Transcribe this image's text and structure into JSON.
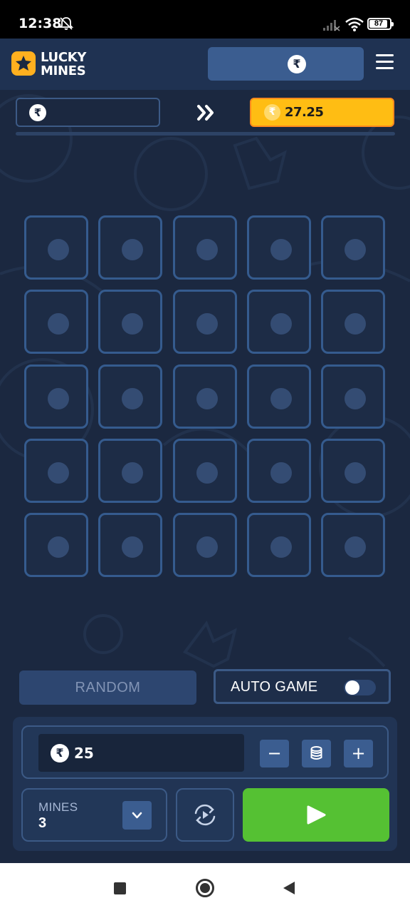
{
  "status_bar": {
    "time": "12:38",
    "battery": "87"
  },
  "header": {
    "logo_line1": "LUCKY",
    "logo_line2": "MINES",
    "currency_symbol": "₹"
  },
  "win_bar": {
    "current_symbol": "₹",
    "next_symbol": "₹",
    "next_value": "27.25"
  },
  "grid": {
    "rows": 5,
    "cols": 5
  },
  "controls": {
    "random_label": "RANDOM",
    "auto_game_label": "AUTO GAME",
    "auto_game_on": false
  },
  "bet": {
    "currency_symbol": "₹",
    "amount": "25",
    "minus_label": "−",
    "plus_label": "+"
  },
  "mines": {
    "label": "MINES",
    "value": "3"
  },
  "colors": {
    "background": "#1b2840",
    "accent_yellow": "#ffbd13",
    "play_green": "#55c133",
    "tile_border": "#355b8e"
  }
}
